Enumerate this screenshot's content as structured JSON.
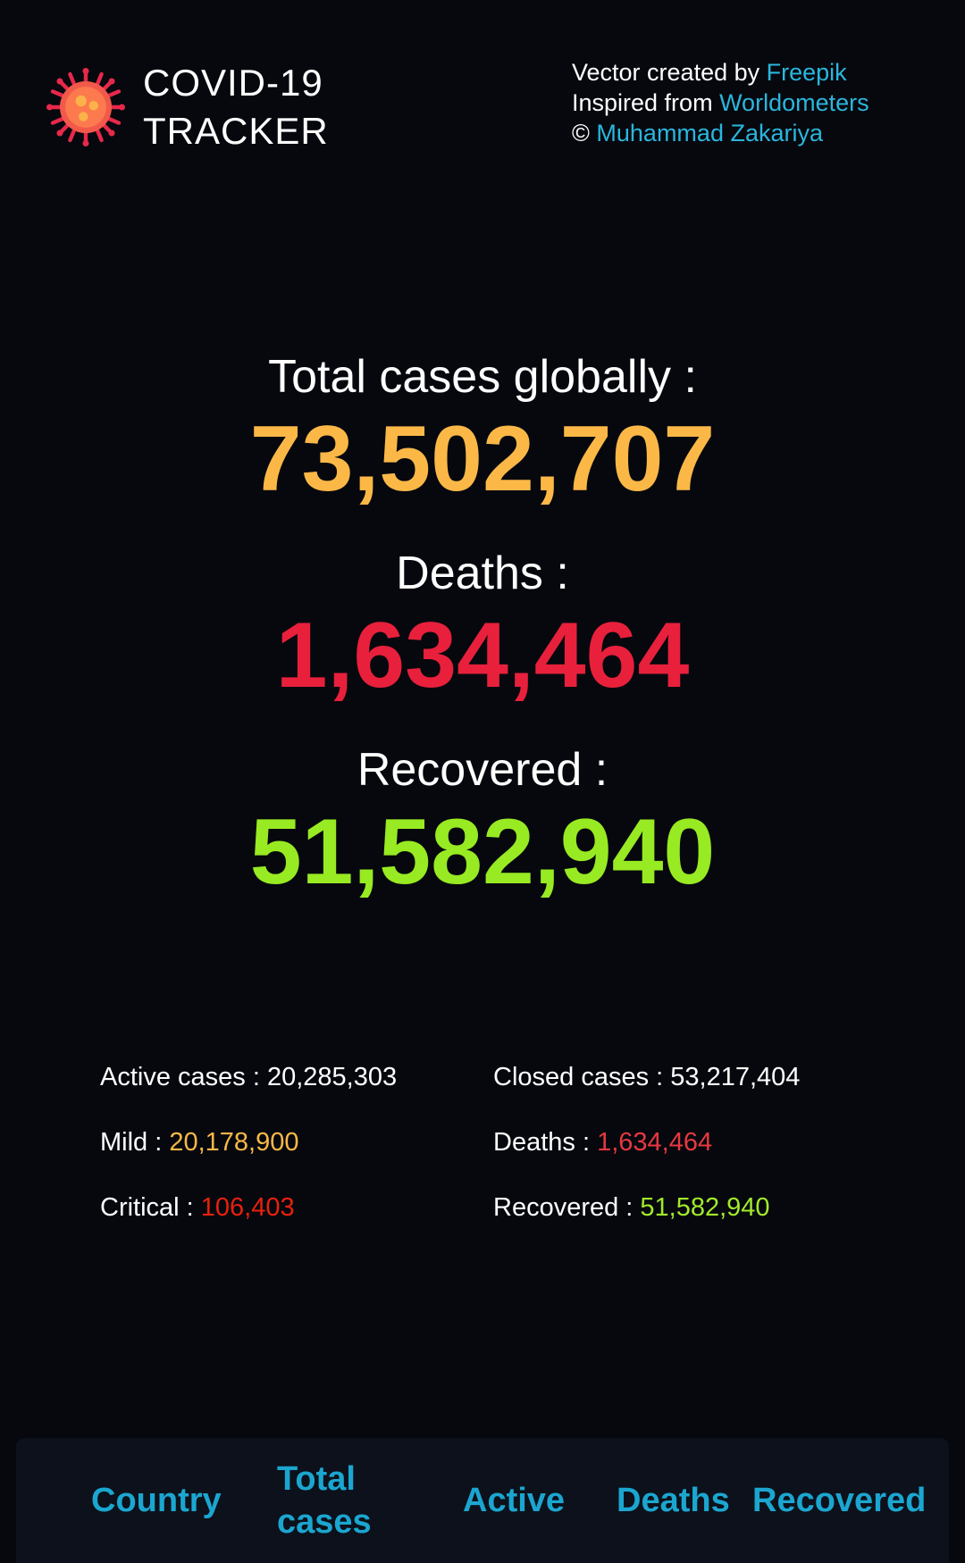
{
  "header": {
    "title_line1": "COVID-19",
    "title_line2": "TRACKER",
    "logo_icon": "virus-icon",
    "credits": {
      "vector_prefix": "Vector created by ",
      "vector_link": "Freepik",
      "inspired_prefix": "Inspired from ",
      "inspired_link": "Worldometers",
      "copyright_prefix": "© ",
      "copyright_link": "Muhammad Zakariya"
    }
  },
  "summary": {
    "total_label": "Total cases globally :",
    "total_value": "73,502,707",
    "deaths_label": "Deaths :",
    "deaths_value": "1,634,464",
    "recovered_label": "Recovered :",
    "recovered_value": "51,582,940"
  },
  "details": {
    "active_label": "Active cases : ",
    "active_value": "20,285,303",
    "mild_label": "Mild : ",
    "mild_value": "20,178,900",
    "critical_label": "Critical : ",
    "critical_value": "106,403",
    "closed_label": "Closed cases : ",
    "closed_value": "53,217,404",
    "deaths_label": "Deaths : ",
    "deaths_value": "1,634,464",
    "recovered_label": "Recovered : ",
    "recovered_value": "51,582,940"
  },
  "table": {
    "columns": {
      "country": "Country",
      "total_line1": "Total",
      "total_line2": "cases",
      "active": "Active",
      "deaths": "Deaths",
      "recovered": "Recovered"
    }
  },
  "colors": {
    "background": "#06080e",
    "link": "#2bb6dd",
    "total": "#fbb847",
    "deaths": "#e8203c",
    "recovered": "#98ea22",
    "table_header": "#1ba6d0"
  }
}
